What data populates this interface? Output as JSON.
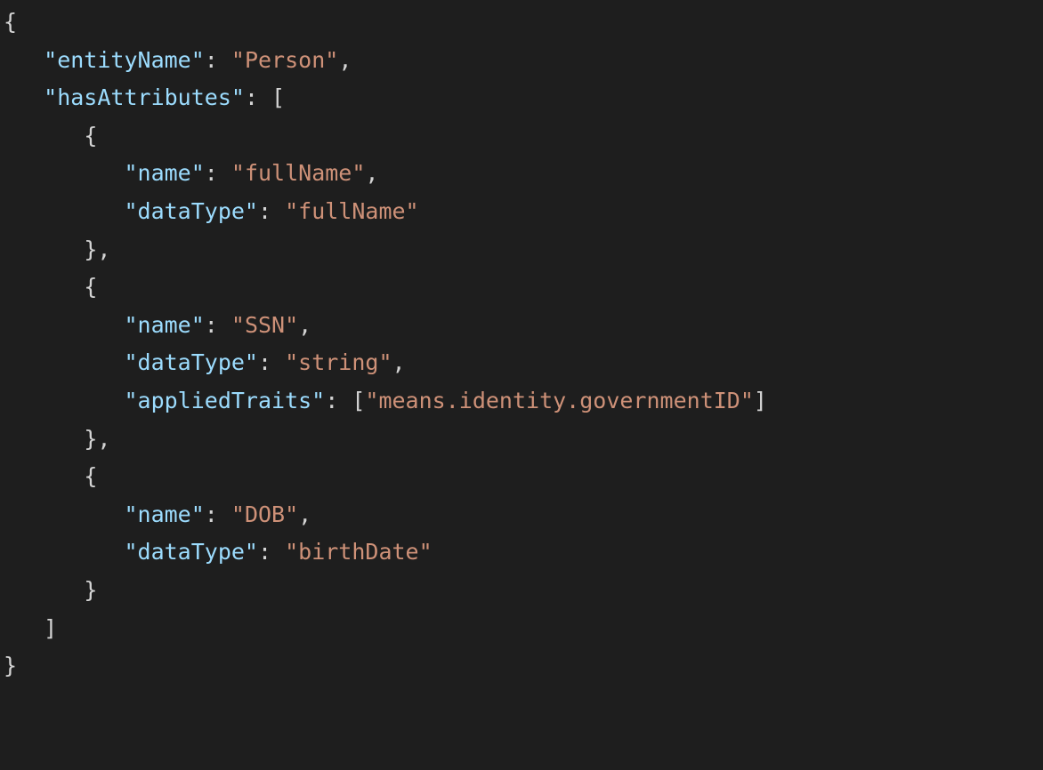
{
  "colors": {
    "background": "#1e1e1e",
    "punctuation": "#d4d4d4",
    "key": "#9cdcfe",
    "string": "#ce9178"
  },
  "code": {
    "entityName_key": "\"entityName\"",
    "entityName_val": "\"Person\"",
    "hasAttributes_key": "\"hasAttributes\"",
    "attr0_name_key": "\"name\"",
    "attr0_name_val": "\"fullName\"",
    "attr0_dataType_key": "\"dataType\"",
    "attr0_dataType_val": "\"fullName\"",
    "attr1_name_key": "\"name\"",
    "attr1_name_val": "\"SSN\"",
    "attr1_dataType_key": "\"dataType\"",
    "attr1_dataType_val": "\"string\"",
    "attr1_appliedTraits_key": "\"appliedTraits\"",
    "attr1_appliedTraits_val0": "\"means.identity.governmentID\"",
    "attr2_name_key": "\"name\"",
    "attr2_name_val": "\"DOB\"",
    "attr2_dataType_key": "\"dataType\"",
    "attr2_dataType_val": "\"birthDate\""
  }
}
